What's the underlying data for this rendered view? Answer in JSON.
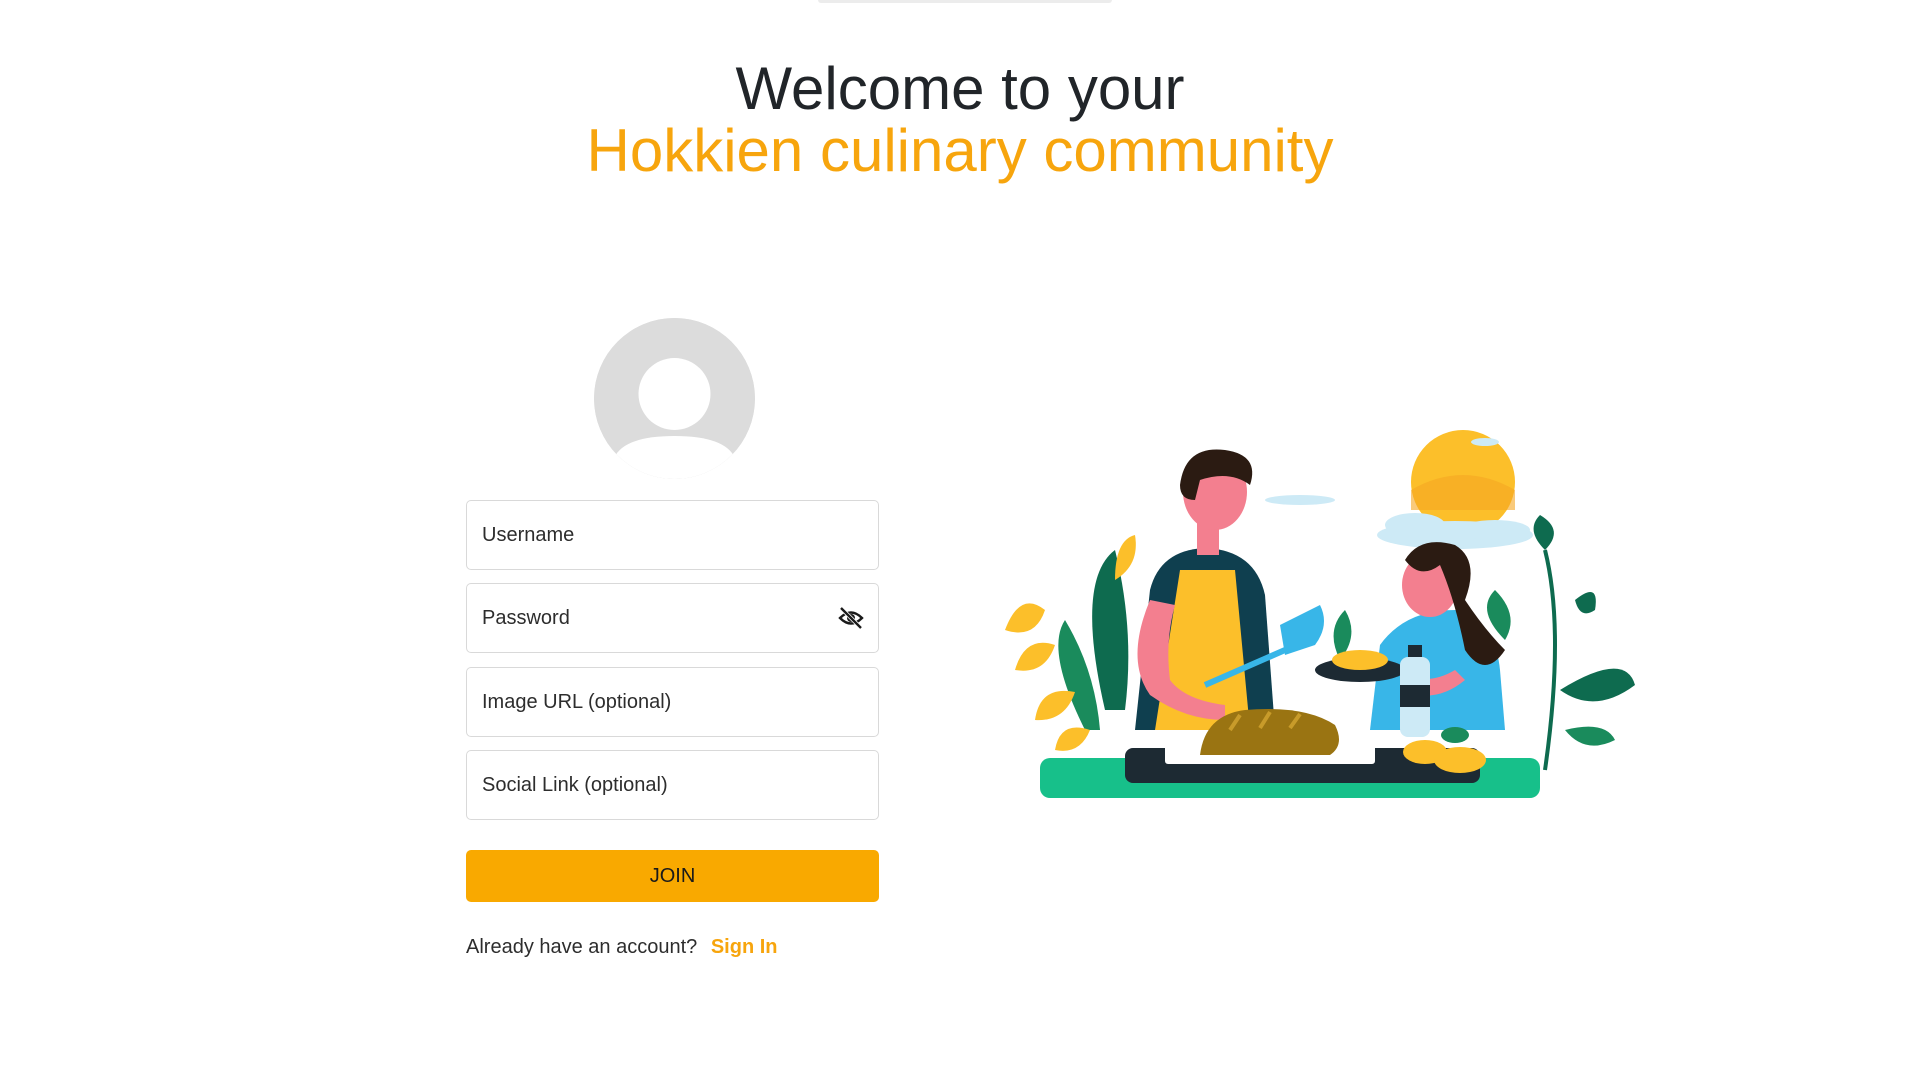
{
  "hero": {
    "line1": "Welcome to your",
    "line2": "Hokkien culinary community"
  },
  "form": {
    "avatar_icon": "default-user-avatar",
    "username": {
      "placeholder": "Username",
      "value": ""
    },
    "password": {
      "placeholder": "Password",
      "value": "",
      "toggle_icon": "eye-off-icon"
    },
    "image_url": {
      "placeholder": "Image URL (optional)",
      "value": ""
    },
    "social_link": {
      "placeholder": "Social Link (optional)",
      "value": ""
    },
    "join_label": "JOIN",
    "signin_prompt": "Already have an account?",
    "signin_link": "Sign In"
  },
  "illustration": {
    "name": "two-people-cooking-illustration"
  },
  "colors": {
    "accent": "#f7a50d",
    "button": "#f9a900",
    "text": "#212529",
    "field_border": "#d9d9d9",
    "avatar_bg": "#dcdcdc"
  }
}
